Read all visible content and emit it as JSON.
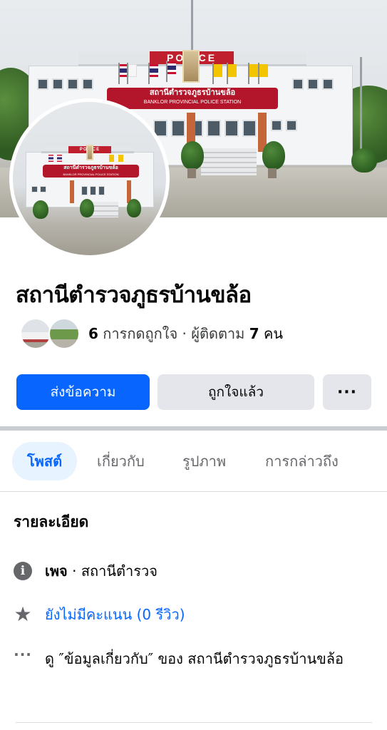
{
  "cover": {
    "police_sign": "POLICE",
    "banner_thai": "สถานีตำรวจภูธรบ้านขล้อ",
    "banner_english": "BANKLOR PROVINCIAL POLICE STATION"
  },
  "page": {
    "name": "สถานีตำรวจภูธรบ้านขล้อ",
    "likes_count": "6",
    "likes_label": "การกดถูกใจ",
    "separator": "·",
    "followers_label": "ผู้ติดตาม",
    "followers_count": "7",
    "followers_unit": "คน"
  },
  "actions": {
    "message_label": "ส่งข้อความ",
    "liked_label": "ถูกใจแล้ว",
    "more_label": "···"
  },
  "tabs": [
    {
      "label": "โพสต์",
      "active": true
    },
    {
      "label": "เกี่ยวกับ",
      "active": false
    },
    {
      "label": "รูปภาพ",
      "active": false
    },
    {
      "label": "การกล่าวถึง",
      "active": false
    }
  ],
  "details": {
    "title": "รายละเอียด",
    "category_prefix": "เพจ",
    "category_sep": " · ",
    "category_value": "สถานีตำรวจ",
    "rating_text": "ยังไม่มีคะแนน (0 รีวิว)",
    "about_text": "ดู ″ข้อมูลเกี่ยวกับ″ ของ สถานีตำรวจภูธรบ้านขล้อ"
  },
  "icons": {
    "info": "info-icon",
    "star": "star-icon",
    "more": "more-dots-icon"
  },
  "colors": {
    "primary": "#0866ff",
    "secondary_button": "#e4e6eb",
    "active_tab_bg": "#e7f3ff",
    "muted_text": "#65676b",
    "banner_red": "#b3162a"
  }
}
